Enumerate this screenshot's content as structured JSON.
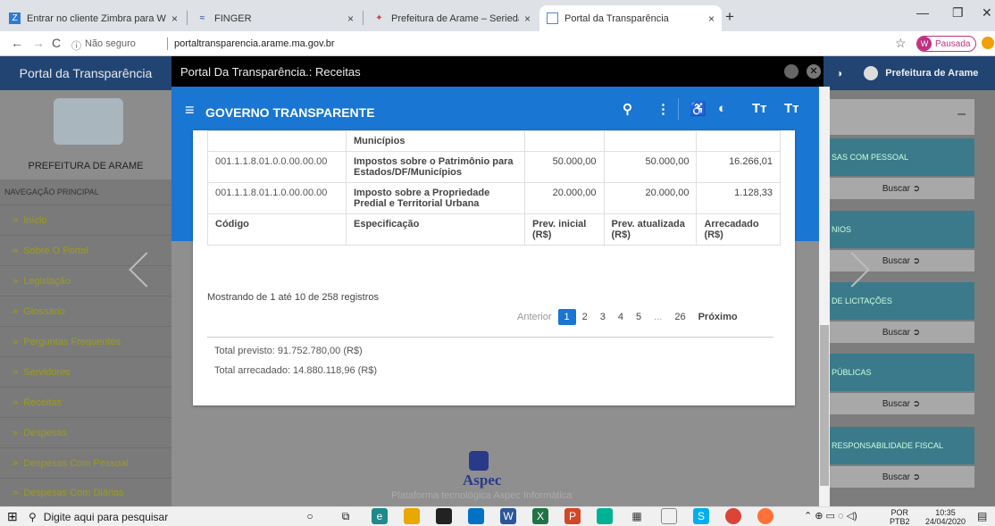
{
  "browser": {
    "tabs": [
      {
        "title": "Entrar no cliente Zimbra para We",
        "icon": "zimbra-icon",
        "color": "#2f7ad8"
      },
      {
        "title": "FINGER",
        "icon": "finger-icon",
        "color": "#1b3a8a"
      },
      {
        "title": "Prefeitura de Arame – Seriedade",
        "icon": "prefeitura-icon",
        "color": "#d04040"
      },
      {
        "title": "Portal da Transparência",
        "icon": "page-icon",
        "color": "#4a8ad4"
      }
    ],
    "security_label": "Não seguro",
    "url": "portaltransparencia.arame.ma.gov.br",
    "profile_letter": "W",
    "profile_status": "Pausada"
  },
  "site": {
    "left_header": "Portal da Transparência",
    "prefeitura_name": "PREFEITURA DE ARAME",
    "nav_label": "NAVEGAÇÃO PRINCIPAL",
    "nav_items": [
      "Início",
      "Sobre O Portal",
      "Legislação",
      "Glossário",
      "Perguntas Frequentes",
      "Servidores",
      "Receitas",
      "Despesas",
      "Despesas Com Pessoal",
      "Despesas Com Diárias"
    ],
    "right_header": "Prefeitura de Arame",
    "right_cards": [
      "SAS COM PESSOAL",
      "NIOS",
      "DE LICITAÇÕES",
      "PÚBLICAS",
      "RESPONSABILIDADE FISCAL"
    ],
    "right_button_label": "Buscar"
  },
  "modal": {
    "title": "Portal Da Transparência.: Receitas",
    "app_title": "GOVERNO TRANSPARENTE",
    "rows": [
      {
        "code": "",
        "spec": "Municípios",
        "prev_inicial": "",
        "prev_atualizada": "",
        "arrecadado": ""
      },
      {
        "code": "001.1.1.8.01.0.0.00.00.00",
        "spec": "Impostos sobre o Patrimônio para Estados/DF/Municípios",
        "prev_inicial": "50.000,00",
        "prev_atualizada": "50.000,00",
        "arrecadado": "16.266,01"
      },
      {
        "code": "001.1.1.8.01.1.0.00.00.00",
        "spec": "Imposto sobre a Propriedade Predial e Territorial Urbana",
        "prev_inicial": "20.000,00",
        "prev_atualizada": "20.000,00",
        "arrecadado": "1.128,33"
      }
    ],
    "columns": [
      "Código",
      "Especificação",
      "Prev. inicial (R$)",
      "Prev. atualizada (R$)",
      "Arrecadado (R$)"
    ],
    "showing": "Mostrando de 1 até 10 de 258 registros",
    "pager": {
      "prev": "Anterior",
      "pages": [
        "1",
        "2",
        "3",
        "4",
        "5",
        "...",
        "26"
      ],
      "next": "Próximo",
      "current": "1"
    },
    "total_previsto": "Total previsto: 91.752.780,00 (R$)",
    "total_arrecadado": "Total arrecadado: 14.880.118,96 (R$)",
    "footer_brand": "Aspec",
    "footer_text": "Plataforma tecnológica Aspec Informática"
  },
  "taskbar": {
    "search_placeholder": "Digite aqui para pesquisar",
    "lang": "POR",
    "lang2": "PTB2",
    "time": "10:35",
    "date": "24/04/2020"
  }
}
